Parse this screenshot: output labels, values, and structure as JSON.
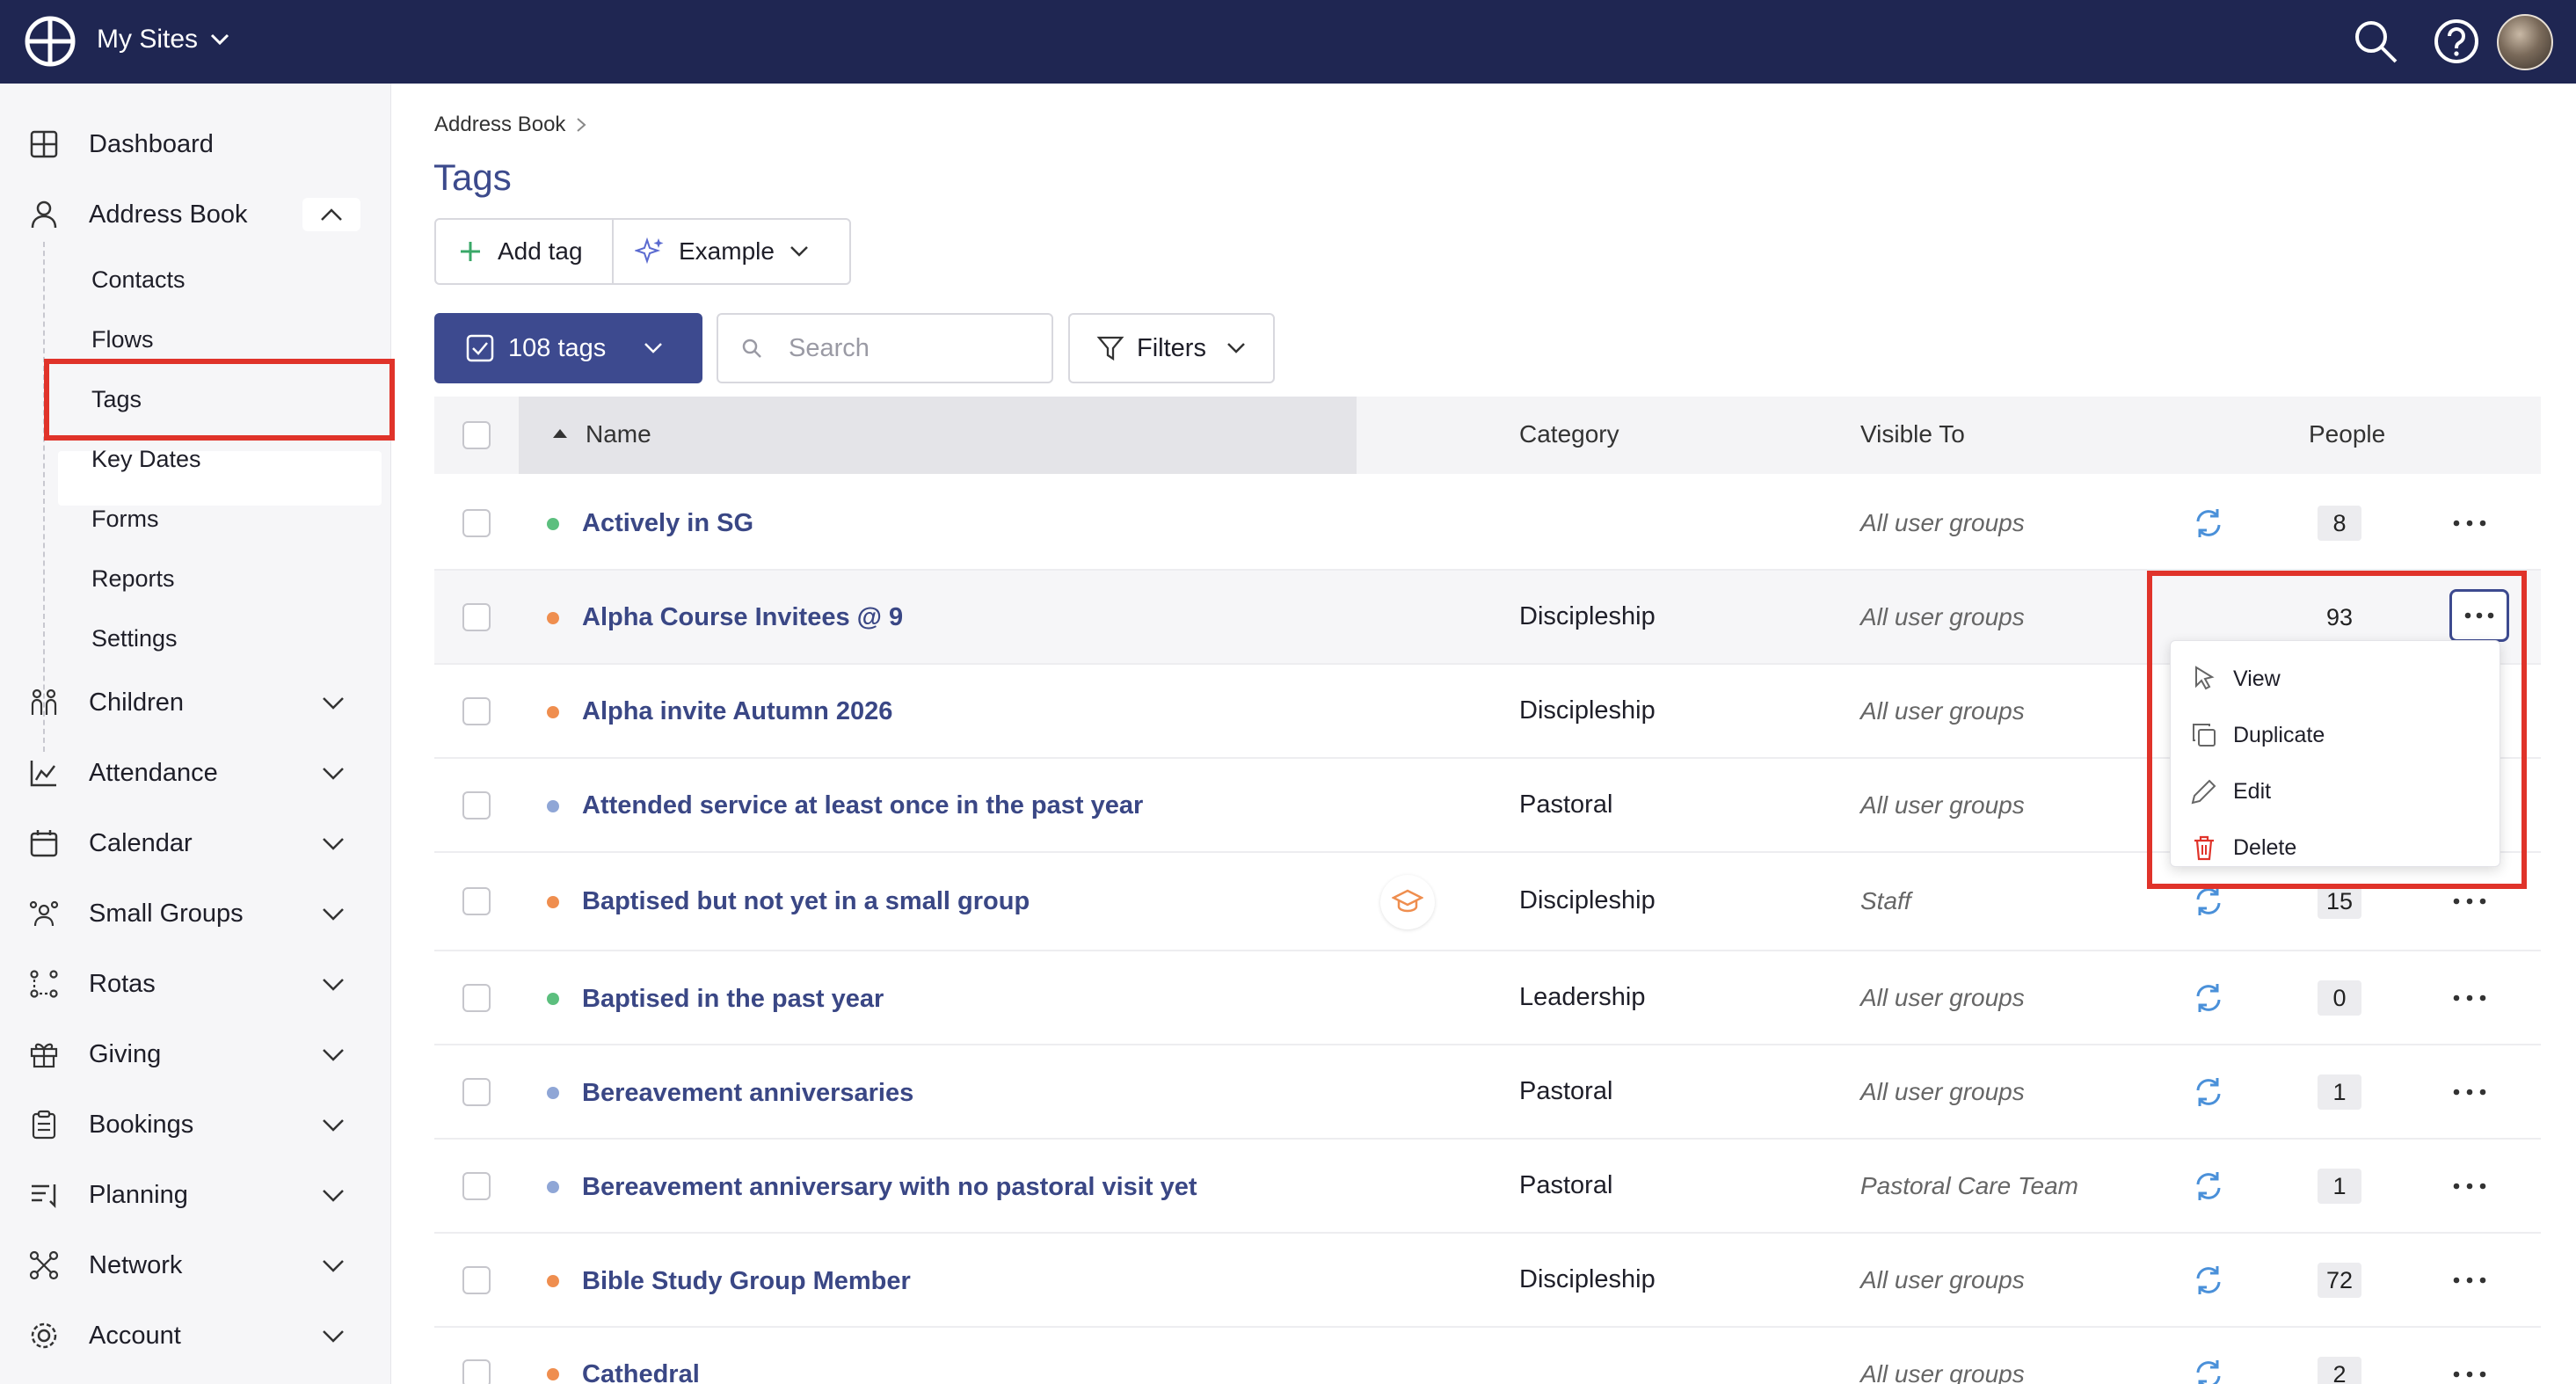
{
  "topbar": {
    "sites_label": "My Sites"
  },
  "sidebar": {
    "items": [
      {
        "label": "Dashboard",
        "icon": "dashboard-icon"
      },
      {
        "label": "Address Book",
        "icon": "person-icon"
      },
      {
        "label": "Children",
        "icon": "children-icon"
      },
      {
        "label": "Attendance",
        "icon": "chart-icon"
      },
      {
        "label": "Calendar",
        "icon": "calendar-icon"
      },
      {
        "label": "Small Groups",
        "icon": "groups-icon"
      },
      {
        "label": "Rotas",
        "icon": "rotas-icon"
      },
      {
        "label": "Giving",
        "icon": "gift-icon"
      },
      {
        "label": "Bookings",
        "icon": "clipboard-icon"
      },
      {
        "label": "Planning",
        "icon": "planning-icon"
      },
      {
        "label": "Network",
        "icon": "network-icon"
      },
      {
        "label": "Account",
        "icon": "gear-icon"
      }
    ],
    "sub_items": [
      "Contacts",
      "Flows",
      "Tags",
      "Key Dates",
      "Forms",
      "Reports",
      "Settings"
    ]
  },
  "breadcrumb": {
    "parent": "Address Book"
  },
  "page": {
    "title": "Tags"
  },
  "toolbar": {
    "add_tag_label": "Add tag",
    "example_label": "Example",
    "tags_count_label": "108 tags",
    "search_placeholder": "Search",
    "filters_label": "Filters"
  },
  "table": {
    "columns": {
      "name": "Name",
      "category": "Category",
      "visible_to": "Visible To",
      "people": "People"
    },
    "rows": [
      {
        "name": "Actively in SG",
        "dot": "#5cbf7e",
        "category": "",
        "visible_to": "All user groups",
        "people": "8"
      },
      {
        "name": "Alpha Course Invitees @ 9",
        "dot": "#ef8e4f",
        "category": "Discipleship",
        "visible_to": "All user groups",
        "people": "93"
      },
      {
        "name": "Alpha invite Autumn 2026",
        "dot": "#ef8e4f",
        "category": "Discipleship",
        "visible_to": "All user groups",
        "people": ""
      },
      {
        "name": "Attended service at least once in the past year",
        "dot": "#8fa6d6",
        "category": "Pastoral",
        "visible_to": "All user groups",
        "people": ""
      },
      {
        "name": "Baptised but not yet in a small group",
        "dot": "#ef8e4f",
        "category": "Discipleship",
        "visible_to": "Staff",
        "people": "15"
      },
      {
        "name": "Baptised in the past year",
        "dot": "#5cbf7e",
        "category": "Leadership",
        "visible_to": "All user groups",
        "people": "0"
      },
      {
        "name": "Bereavement anniversaries",
        "dot": "#8fa6d6",
        "category": "Pastoral",
        "visible_to": "All user groups",
        "people": "1"
      },
      {
        "name": "Bereavement anniversary with no pastoral visit yet",
        "dot": "#8fa6d6",
        "category": "Pastoral",
        "visible_to": "Pastoral Care Team",
        "people": "1"
      },
      {
        "name": "Bible Study Group Member",
        "dot": "#ef8e4f",
        "category": "Discipleship",
        "visible_to": "All user groups",
        "people": "72"
      },
      {
        "name": "Cathedral",
        "dot": "#ef8e4f",
        "category": "",
        "visible_to": "All user groups",
        "people": "2"
      }
    ]
  },
  "context_menu": {
    "items": [
      {
        "label": "View",
        "icon": "pointer-icon"
      },
      {
        "label": "Duplicate",
        "icon": "duplicate-icon"
      },
      {
        "label": "Edit",
        "icon": "pencil-icon"
      },
      {
        "label": "Delete",
        "icon": "trash-icon"
      }
    ]
  },
  "colors": {
    "topbar": "#1f2652",
    "accent": "#3d4a8f",
    "highlight": "#e0332a",
    "link": "#3a4785"
  }
}
